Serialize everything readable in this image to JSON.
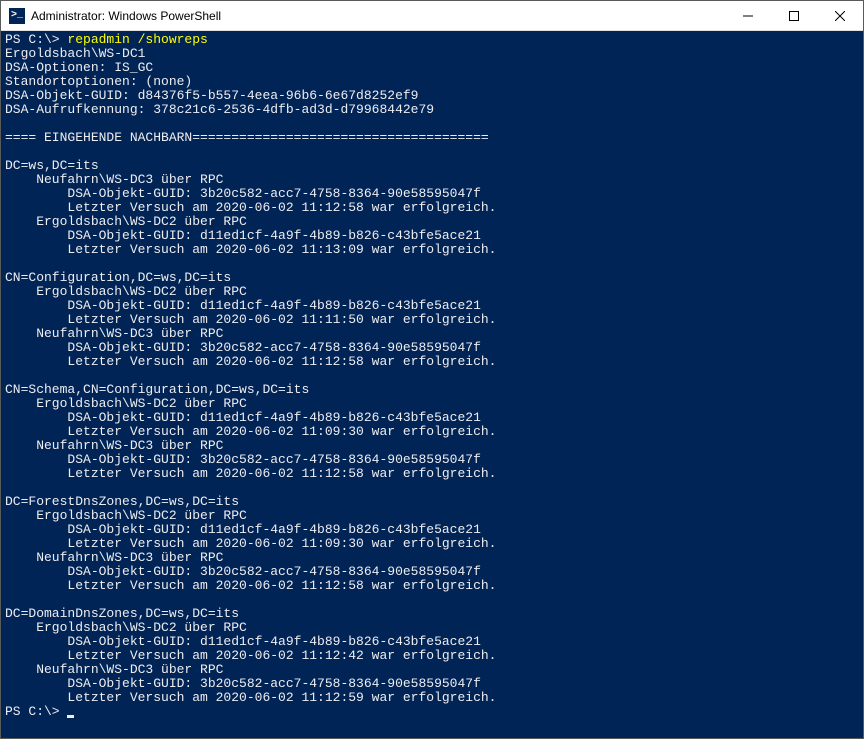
{
  "window": {
    "title": "Administrator: Windows PowerShell",
    "icon_glyph": ">_"
  },
  "terminal": {
    "prompt1": "PS C:\\>",
    "command": " repadmin /showreps",
    "header": {
      "site_dc": "Ergoldsbach\\WS-DC1",
      "dsa_options": "DSA-Optionen: IS_GC",
      "standort": "Standortoptionen: (none)",
      "dsa_guid": "DSA-Objekt-GUID: d84376f5-b557-4eea-96b6-6e67d8252ef9",
      "dsa_call": "DSA-Aufrufkennung: 378c21c6-2536-4dfb-ad3d-d79968442e79"
    },
    "section_header": "==== EINGEHENDE NACHBARN======================================",
    "sections": [
      {
        "context": "DC=ws,DC=its",
        "neighbors": [
          {
            "name": "    Neufahrn\\WS-DC3 über RPC",
            "guid": "        DSA-Objekt-GUID: 3b20c582-acc7-4758-8364-90e58595047f",
            "attempt": "        Letzter Versuch am 2020-06-02 11:12:58 war erfolgreich."
          },
          {
            "name": "    Ergoldsbach\\WS-DC2 über RPC",
            "guid": "        DSA-Objekt-GUID: d11ed1cf-4a9f-4b89-b826-c43bfe5ace21",
            "attempt": "        Letzter Versuch am 2020-06-02 11:13:09 war erfolgreich."
          }
        ]
      },
      {
        "context": "CN=Configuration,DC=ws,DC=its",
        "neighbors": [
          {
            "name": "    Ergoldsbach\\WS-DC2 über RPC",
            "guid": "        DSA-Objekt-GUID: d11ed1cf-4a9f-4b89-b826-c43bfe5ace21",
            "attempt": "        Letzter Versuch am 2020-06-02 11:11:50 war erfolgreich."
          },
          {
            "name": "    Neufahrn\\WS-DC3 über RPC",
            "guid": "        DSA-Objekt-GUID: 3b20c582-acc7-4758-8364-90e58595047f",
            "attempt": "        Letzter Versuch am 2020-06-02 11:12:58 war erfolgreich."
          }
        ]
      },
      {
        "context": "CN=Schema,CN=Configuration,DC=ws,DC=its",
        "neighbors": [
          {
            "name": "    Ergoldsbach\\WS-DC2 über RPC",
            "guid": "        DSA-Objekt-GUID: d11ed1cf-4a9f-4b89-b826-c43bfe5ace21",
            "attempt": "        Letzter Versuch am 2020-06-02 11:09:30 war erfolgreich."
          },
          {
            "name": "    Neufahrn\\WS-DC3 über RPC",
            "guid": "        DSA-Objekt-GUID: 3b20c582-acc7-4758-8364-90e58595047f",
            "attempt": "        Letzter Versuch am 2020-06-02 11:12:58 war erfolgreich."
          }
        ]
      },
      {
        "context": "DC=ForestDnsZones,DC=ws,DC=its",
        "neighbors": [
          {
            "name": "    Ergoldsbach\\WS-DC2 über RPC",
            "guid": "        DSA-Objekt-GUID: d11ed1cf-4a9f-4b89-b826-c43bfe5ace21",
            "attempt": "        Letzter Versuch am 2020-06-02 11:09:30 war erfolgreich."
          },
          {
            "name": "    Neufahrn\\WS-DC3 über RPC",
            "guid": "        DSA-Objekt-GUID: 3b20c582-acc7-4758-8364-90e58595047f",
            "attempt": "        Letzter Versuch am 2020-06-02 11:12:58 war erfolgreich."
          }
        ]
      },
      {
        "context": "DC=DomainDnsZones,DC=ws,DC=its",
        "neighbors": [
          {
            "name": "    Ergoldsbach\\WS-DC2 über RPC",
            "guid": "        DSA-Objekt-GUID: d11ed1cf-4a9f-4b89-b826-c43bfe5ace21",
            "attempt": "        Letzter Versuch am 2020-06-02 11:12:42 war erfolgreich."
          },
          {
            "name": "    Neufahrn\\WS-DC3 über RPC",
            "guid": "        DSA-Objekt-GUID: 3b20c582-acc7-4758-8364-90e58595047f",
            "attempt": "        Letzter Versuch am 2020-06-02 11:12:59 war erfolgreich."
          }
        ]
      }
    ],
    "prompt2": "PS C:\\> "
  }
}
